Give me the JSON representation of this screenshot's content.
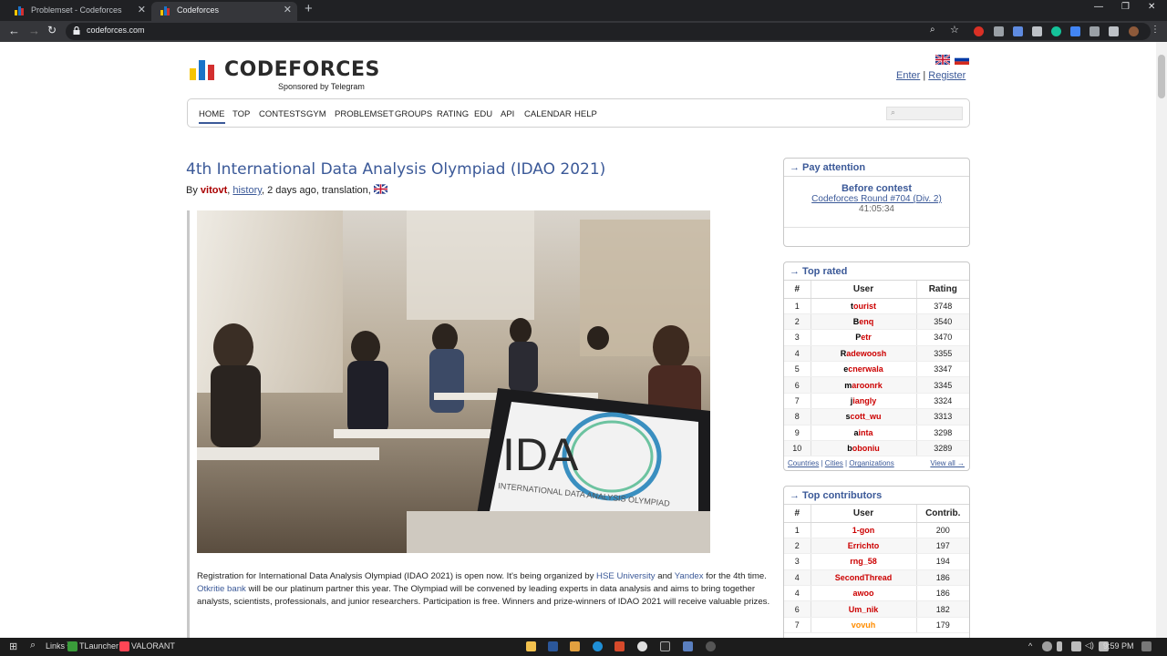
{
  "browser": {
    "tabs": [
      {
        "title": "Problemset - Codeforces"
      },
      {
        "title": "Codeforces"
      }
    ],
    "url": "codeforces.com"
  },
  "header": {
    "logo_text": "CODEFORCES",
    "logo_sub": "Sponsored by Telegram",
    "enter": "Enter",
    "separator": "|",
    "register": "Register"
  },
  "menu": [
    "HOME",
    "TOP",
    "CONTESTS",
    "GYM",
    "PROBLEMSET",
    "GROUPS",
    "RATING",
    "EDU",
    "API",
    "CALENDAR",
    "HELP"
  ],
  "post": {
    "title": "4th International Data Analysis Olympiad (IDAO 2021)",
    "by": "By",
    "author": "vitovt",
    "history": "history",
    "meta_rest": ", 2 days ago, translation,",
    "image_text_big": "IDA",
    "image_text_small": "INTERNATIONAL DATA ANALYSIS OLYMPIAD",
    "text_1": "Registration for International Data Analysis Olympiad (IDAO 2021) is open now. It's being organized by ",
    "link_hse": "HSE University",
    "text_and": " and ",
    "link_yandex": "Yandex",
    "text_2": " for the 4th time. ",
    "link_otkritie": "Otkritie bank",
    "text_3": " will be our platinum partner this year. The Olympiad will be convened by leading experts in data analysis and aims to bring together analysts, scientists, professionals, and junior researchers. Participation is free. Winners and prize-winners of IDAO 2021 will receive valuable prizes."
  },
  "pay_attention": {
    "title": "→ Pay attention",
    "before": "Before contest",
    "round": "Codeforces Round #704 (Div. 2)",
    "timer": "41:05:34"
  },
  "top_rated": {
    "title": "→ Top rated",
    "headers": [
      "#",
      "User",
      "Rating"
    ],
    "rows": [
      {
        "rank": "1",
        "first": "t",
        "rest": "ourist",
        "value": "3748"
      },
      {
        "rank": "2",
        "first": "B",
        "rest": "enq",
        "value": "3540"
      },
      {
        "rank": "3",
        "first": "P",
        "rest": "etr",
        "value": "3470"
      },
      {
        "rank": "4",
        "first": "R",
        "rest": "adewoosh",
        "value": "3355"
      },
      {
        "rank": "5",
        "first": "e",
        "rest": "cnerwala",
        "value": "3347"
      },
      {
        "rank": "6",
        "first": "m",
        "rest": "aroonrk",
        "value": "3345"
      },
      {
        "rank": "7",
        "first": "j",
        "rest": "iangly",
        "value": "3324"
      },
      {
        "rank": "8",
        "first": "s",
        "rest": "cott_wu",
        "value": "3313"
      },
      {
        "rank": "9",
        "first": "a",
        "rest": "inta",
        "value": "3298"
      },
      {
        "rank": "10",
        "first": "b",
        "rest": "oboniu",
        "value": "3289"
      }
    ],
    "footer": {
      "countries": "Countries",
      "cities": "Cities",
      "organizations": "Organizations",
      "sep": "|",
      "view_all": "View all →"
    }
  },
  "top_contributors": {
    "title": "→ Top contributors",
    "headers": [
      "#",
      "User",
      "Contrib."
    ],
    "rows": [
      {
        "rank": "1",
        "name": "1-gon",
        "value": "200",
        "color": "red"
      },
      {
        "rank": "2",
        "name": "Errichto",
        "value": "197",
        "color": "red"
      },
      {
        "rank": "3",
        "name": "rng_58",
        "value": "194",
        "color": "red"
      },
      {
        "rank": "4",
        "name": "SecondThread",
        "value": "186",
        "color": "red"
      },
      {
        "rank": "4",
        "name": "awoo",
        "value": "186",
        "color": "red"
      },
      {
        "rank": "6",
        "name": "Um_nik",
        "value": "182",
        "color": "red"
      },
      {
        "rank": "7",
        "name": "vovuh",
        "value": "179",
        "color": "orange"
      }
    ]
  },
  "taskbar": {
    "links": "Links",
    "tlauncher": "TLauncher",
    "valorant": "VALORANT",
    "time": "9:59 PM"
  },
  "colors": {
    "accent": "#3b5998",
    "red_user": "#cc0000",
    "orange_user": "#ff8c00"
  }
}
